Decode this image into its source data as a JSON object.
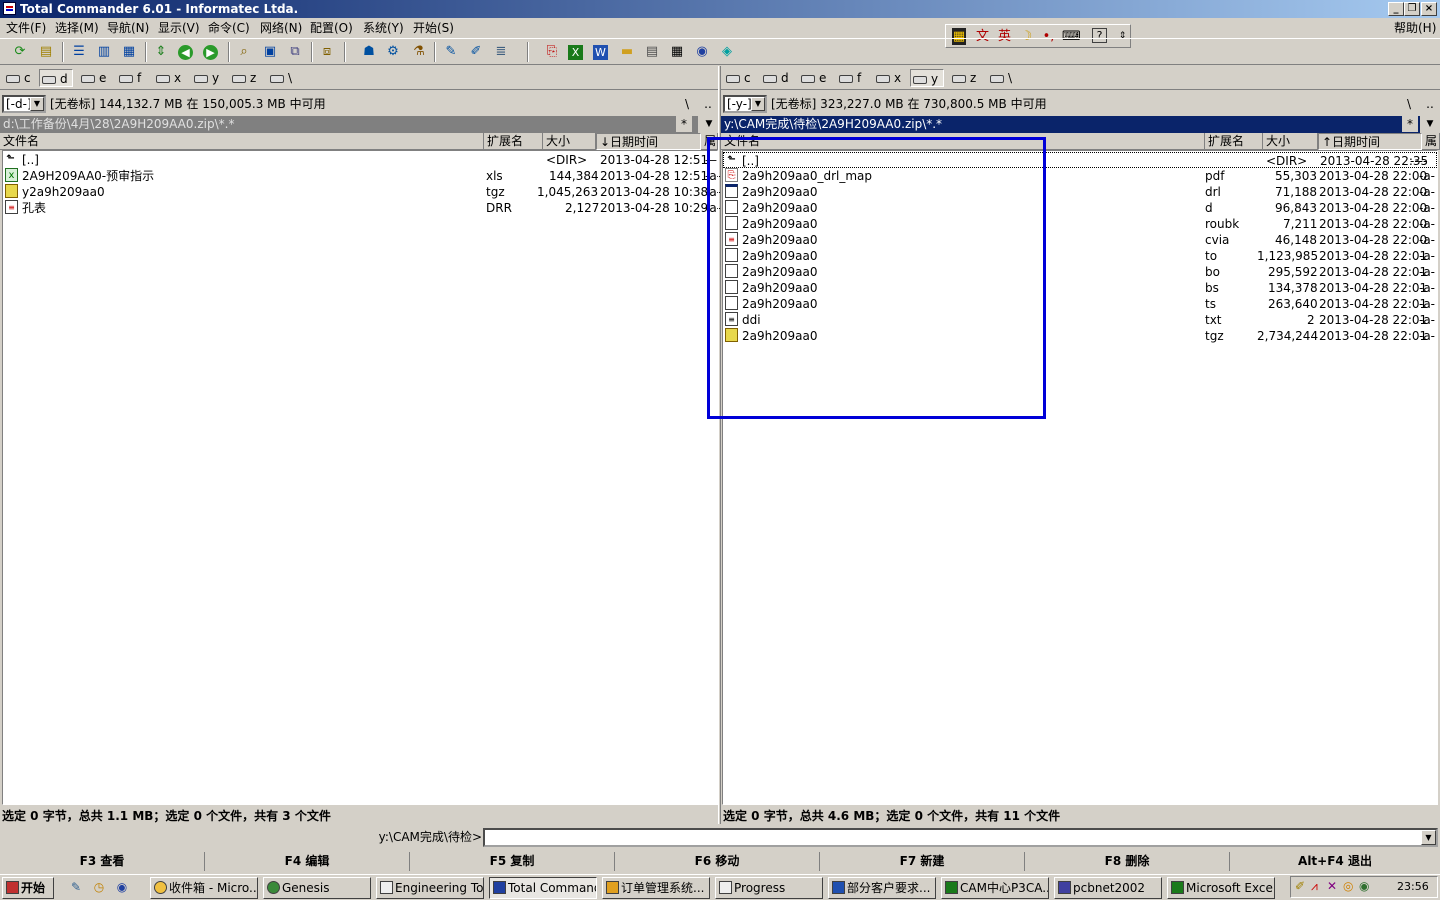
{
  "window": {
    "title": "Total Commander 6.01 - Informatec Ltda."
  },
  "menu": {
    "items": [
      "文件(F)",
      "选择(M)",
      "导航(N)",
      "显示(V)",
      "命令(C)",
      "网络(N)",
      "配置(O)",
      "系统(Y)",
      "开始(S)"
    ],
    "help": "帮助(H)"
  },
  "ime": {
    "icons": [
      "ime-logo-icon",
      "ime-mode-icon",
      "ime-english-icon",
      "moon-icon",
      "punct-icon",
      "softkbd-icon",
      "help-icon",
      "menu-icon"
    ],
    "lang_label": "英"
  },
  "toolbar": {
    "icons": [
      "refresh-icon",
      "pack-icon",
      "brief-view-icon",
      "full-view-icon",
      "tree-view-icon",
      "swap-icon",
      "back-icon",
      "forward-icon",
      "find-icon",
      "view-icon",
      "compare-icon",
      "sync-icon",
      "user-icon",
      "settings-icon",
      "plugin-icon",
      "notepad-icon",
      "edit-icon",
      "multirename-icon",
      "pdf-icon",
      "excel-icon",
      "word-icon",
      "folder-icon",
      "archive-icon",
      "calc-icon",
      "browser-icon",
      "paint-icon"
    ]
  },
  "left_panel": {
    "drives": [
      "c",
      "d",
      "e",
      "f",
      "x",
      "y",
      "z",
      "\\"
    ],
    "selected_drive": "d",
    "drive_combo": "[-d-]",
    "drive_info": "[无卷标]  144,132.7 MB 在 150,005.3 MB 中可用",
    "path": "d:\\工作备份\\4月\\28\\2A9H209AA0.zip\\*.*",
    "path_star": "*",
    "root_btn": "\\",
    "up_btn": "..",
    "headers": {
      "name": "文件名",
      "ext": "扩展名",
      "size": "大小",
      "date": "↓日期时间",
      "attr": "属"
    },
    "files": [
      {
        "name": "[..]",
        "ext": "",
        "size": "<DIR>",
        "date": "2013-04-28 12:51",
        "attr": "—",
        "icon": "up-icon"
      },
      {
        "name": "2A9H209AA0-预审指示",
        "ext": "xls",
        "size": "144,384",
        "date": "2013-04-28 12:51",
        "attr": "-a-",
        "icon": "excel-icon"
      },
      {
        "name": "y2a9h209aa0",
        "ext": "tgz",
        "size": "1,045,263",
        "date": "2013-04-28 10:38",
        "attr": "-a-",
        "icon": "archive-icon"
      },
      {
        "name": "孔表",
        "ext": "DRR",
        "size": "2,127",
        "date": "2013-04-28 10:29",
        "attr": "-a-",
        "icon": "doc-icon"
      }
    ],
    "status": "选定 0 字节，总共 1.1 MB；选定 0 个文件，共有 3 个文件"
  },
  "right_panel": {
    "drives": [
      "c",
      "d",
      "e",
      "f",
      "x",
      "y",
      "z",
      "\\"
    ],
    "selected_drive": "y",
    "drive_combo": "[-y-]",
    "drive_info": "[无卷标]  323,227.0 MB 在 730,800.5 MB 中可用",
    "path": "y:\\CAM完成\\待检\\2A9H209AA0.zip\\*.*",
    "path_star": "*",
    "root_btn": "\\",
    "up_btn": "..",
    "headers": {
      "name": "文件名",
      "ext": "扩展名",
      "size": "大小",
      "date": "↑日期时间",
      "attr": "属"
    },
    "files": [
      {
        "name": "[..]",
        "ext": "",
        "size": "<DIR>",
        "date": "2013-04-28 22:35",
        "attr": "----",
        "icon": "up-icon"
      },
      {
        "name": "2a9h209aa0_drl_map",
        "ext": "pdf",
        "size": "55,303",
        "date": "2013-04-28 22:00",
        "attr": "-a-",
        "icon": "pdf-icon"
      },
      {
        "name": "2a9h209aa0",
        "ext": "drl",
        "size": "71,188",
        "date": "2013-04-28 22:00",
        "attr": "-a-",
        "icon": "window-icon"
      },
      {
        "name": "2a9h209aa0",
        "ext": "d",
        "size": "96,843",
        "date": "2013-04-28 22:00",
        "attr": "-a-",
        "icon": "doc-icon"
      },
      {
        "name": "2a9h209aa0",
        "ext": "roubk",
        "size": "7,211",
        "date": "2013-04-28 22:00",
        "attr": "-a-",
        "icon": "doc-icon"
      },
      {
        "name": "2a9h209aa0",
        "ext": "cvia",
        "size": "46,148",
        "date": "2013-04-28 22:00",
        "attr": "-a-",
        "icon": "doc-red-icon"
      },
      {
        "name": "2a9h209aa0",
        "ext": "to",
        "size": "1,123,985",
        "date": "2013-04-28 22:01",
        "attr": "-a-",
        "icon": "doc-icon"
      },
      {
        "name": "2a9h209aa0",
        "ext": "bo",
        "size": "295,592",
        "date": "2013-04-28 22:01",
        "attr": "-a-",
        "icon": "doc-icon"
      },
      {
        "name": "2a9h209aa0",
        "ext": "bs",
        "size": "134,378",
        "date": "2013-04-28 22:01",
        "attr": "-a-",
        "icon": "doc-icon"
      },
      {
        "name": "2a9h209aa0",
        "ext": "ts",
        "size": "263,640",
        "date": "2013-04-28 22:01",
        "attr": "-a-",
        "icon": "doc-icon"
      },
      {
        "name": "ddi",
        "ext": "txt",
        "size": "2",
        "date": "2013-04-28 22:01",
        "attr": "-a-",
        "icon": "text-icon"
      },
      {
        "name": "2a9h209aa0",
        "ext": "tgz",
        "size": "2,734,244",
        "date": "2013-04-28 22:01",
        "attr": "-a-",
        "icon": "archive-icon"
      }
    ],
    "status": "选定 0 字节，总共 4.6 MB；选定 0 个文件，共有 11 个文件"
  },
  "cmdline": {
    "label": "y:\\CAM完成\\待检>",
    "value": ""
  },
  "fkeys": [
    "F3 查看",
    "F4 编辑",
    "F5 复制",
    "F6 移动",
    "F7 新建",
    "F8 删除",
    "Alt+F4 退出"
  ],
  "taskbar": {
    "start": "开始",
    "tasks": [
      "收件箱 - Micro...",
      "Genesis",
      "Engineering To...",
      "Total Command...",
      "订单管理系统...",
      "Progress",
      "部分客户要求...",
      "CAM中心P3CA...",
      "pcbnet2002",
      "Microsoft Excel..."
    ],
    "active_task": "Total Command...",
    "clock": "23:56"
  },
  "colors": {
    "titlebar": "#0a246a",
    "active_path": "#0a246a",
    "inactive_path": "#808080",
    "highlight_box": "#0000d8"
  }
}
